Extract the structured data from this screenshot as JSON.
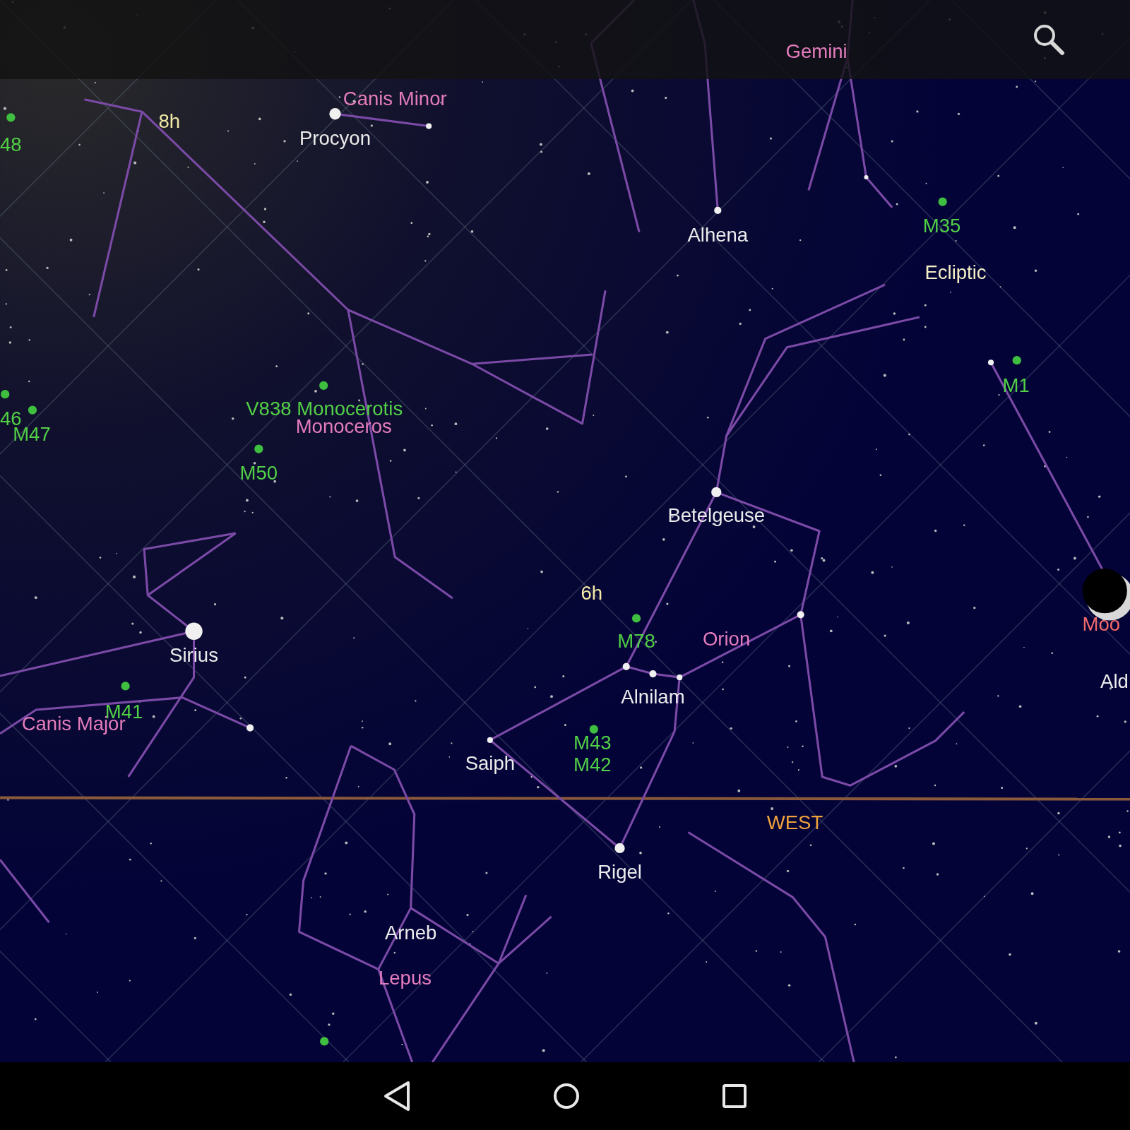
{
  "labels": [
    {
      "text": "Gemini",
      "kind": "constellation"
    },
    {
      "text": "8h",
      "kind": "grid"
    },
    {
      "text": "Canis Minor",
      "kind": "constellation"
    },
    {
      "text": "Procyon",
      "kind": "star"
    },
    {
      "text": "48",
      "kind": "messier"
    },
    {
      "text": "Alhena",
      "kind": "star"
    },
    {
      "text": "M35",
      "kind": "messier"
    },
    {
      "text": "Ecliptic",
      "kind": "ecliptic"
    },
    {
      "text": "M1",
      "kind": "messier"
    },
    {
      "text": "46",
      "kind": "messier"
    },
    {
      "text": "M47",
      "kind": "messier"
    },
    {
      "text": "V838 Monocerotis",
      "kind": "messier"
    },
    {
      "text": "Monoceros",
      "kind": "constellation"
    },
    {
      "text": "M50",
      "kind": "messier"
    },
    {
      "text": "Betelgeuse",
      "kind": "star"
    },
    {
      "text": "6h",
      "kind": "grid"
    },
    {
      "text": "M78",
      "kind": "messier"
    },
    {
      "text": "Orion",
      "kind": "constellation"
    },
    {
      "text": "Moo",
      "kind": "planet"
    },
    {
      "text": "Sirius",
      "kind": "star"
    },
    {
      "text": "Ald",
      "kind": "star"
    },
    {
      "text": "Alnilam",
      "kind": "star"
    },
    {
      "text": "M41",
      "kind": "messier"
    },
    {
      "text": "Canis Major",
      "kind": "constellation"
    },
    {
      "text": "M43",
      "kind": "messier"
    },
    {
      "text": "M42",
      "kind": "messier"
    },
    {
      "text": "Saiph",
      "kind": "star"
    },
    {
      "text": "WEST",
      "kind": "horizon"
    },
    {
      "text": "Rigel",
      "kind": "star"
    },
    {
      "text": "Arneb",
      "kind": "star"
    },
    {
      "text": "Lepus",
      "kind": "constellation"
    }
  ]
}
